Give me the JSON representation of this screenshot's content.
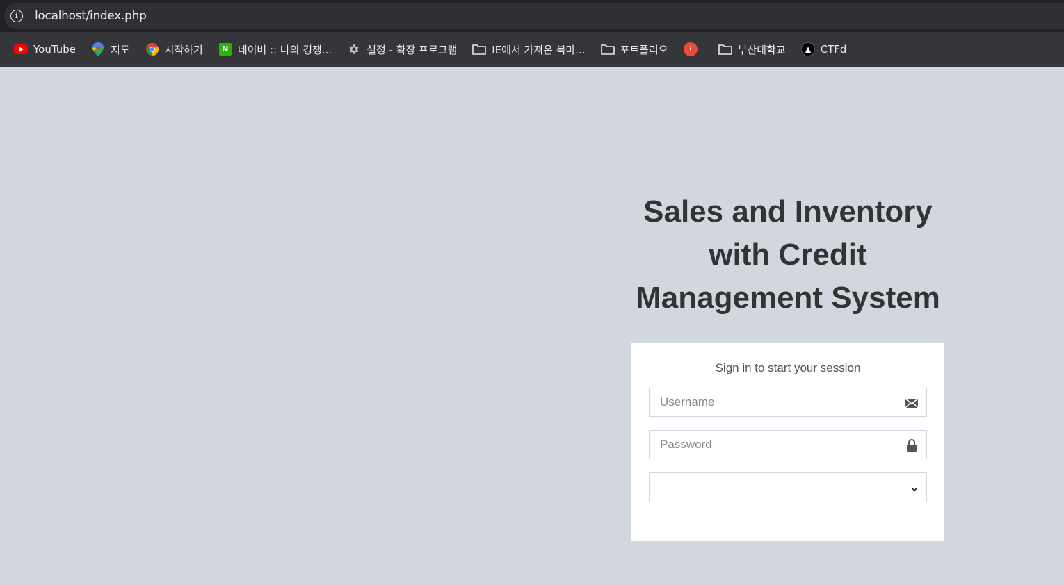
{
  "browser": {
    "url": "localhost/index.php",
    "bookmarks": [
      {
        "label": "YouTube",
        "icon": "youtube-icon"
      },
      {
        "label": "지도",
        "icon": "maps-pin-icon"
      },
      {
        "label": "시작하기",
        "icon": "chrome-icon"
      },
      {
        "label": "네이버 :: 나의 경쟁...",
        "icon": "naver-icon"
      },
      {
        "label": "설정 - 확장 프로그램",
        "icon": "gear-icon"
      },
      {
        "label": "IE에서 가져온 북마...",
        "icon": "folder-icon"
      },
      {
        "label": "포트폴리오",
        "icon": "folder-icon"
      },
      {
        "label": "",
        "icon": "red-app-icon"
      },
      {
        "label": "부산대학교",
        "icon": "folder-icon"
      },
      {
        "label": "CTFd",
        "icon": "ctfd-icon"
      }
    ]
  },
  "page": {
    "title_line1": "Sales and Inventory",
    "title_line2": "with Credit",
    "title_line3": "Management System",
    "login": {
      "message": "Sign in to start your session",
      "username_placeholder": "Username",
      "password_placeholder": "Password",
      "role_selected": ""
    }
  },
  "colors": {
    "page_bg": "#d2d6de",
    "title": "#333333",
    "box_bg": "#ffffff"
  }
}
